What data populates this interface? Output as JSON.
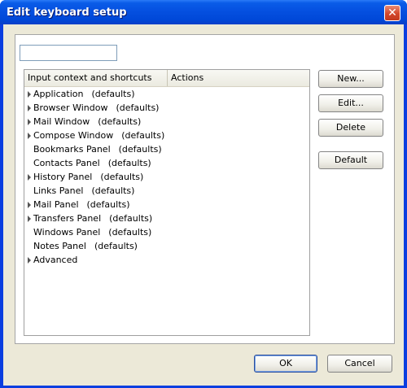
{
  "window": {
    "title": "Edit keyboard setup",
    "close_label": "✕"
  },
  "search": {
    "value": "",
    "placeholder": ""
  },
  "tree": {
    "columns": [
      "Input context and shortcuts",
      "Actions"
    ],
    "rows": [
      {
        "label": "Application",
        "suffix": "(defaults)",
        "expandable": true
      },
      {
        "label": "Browser Window",
        "suffix": "(defaults)",
        "expandable": true
      },
      {
        "label": "Mail Window",
        "suffix": "(defaults)",
        "expandable": true
      },
      {
        "label": "Compose Window",
        "suffix": "(defaults)",
        "expandable": true
      },
      {
        "label": "Bookmarks Panel",
        "suffix": "(defaults)",
        "expandable": false
      },
      {
        "label": "Contacts Panel",
        "suffix": "(defaults)",
        "expandable": false
      },
      {
        "label": "History Panel",
        "suffix": "(defaults)",
        "expandable": true
      },
      {
        "label": "Links Panel",
        "suffix": "(defaults)",
        "expandable": false
      },
      {
        "label": "Mail Panel",
        "suffix": "(defaults)",
        "expandable": true
      },
      {
        "label": "Transfers Panel",
        "suffix": "(defaults)",
        "expandable": true
      },
      {
        "label": "Windows Panel",
        "suffix": "(defaults)",
        "expandable": false
      },
      {
        "label": "Notes Panel",
        "suffix": "(defaults)",
        "expandable": false
      },
      {
        "label": "Advanced",
        "suffix": "",
        "expandable": true
      }
    ]
  },
  "buttons": {
    "new": "New...",
    "edit": "Edit...",
    "delete": "Delete",
    "default": "Default",
    "ok": "OK",
    "cancel": "Cancel"
  },
  "icons": {
    "expander": "triangle-right-icon",
    "close": "close-icon"
  },
  "colors": {
    "titlebar": "#0550e0",
    "dialog_bg": "#ece9d8",
    "close_button": "#d3462a"
  }
}
